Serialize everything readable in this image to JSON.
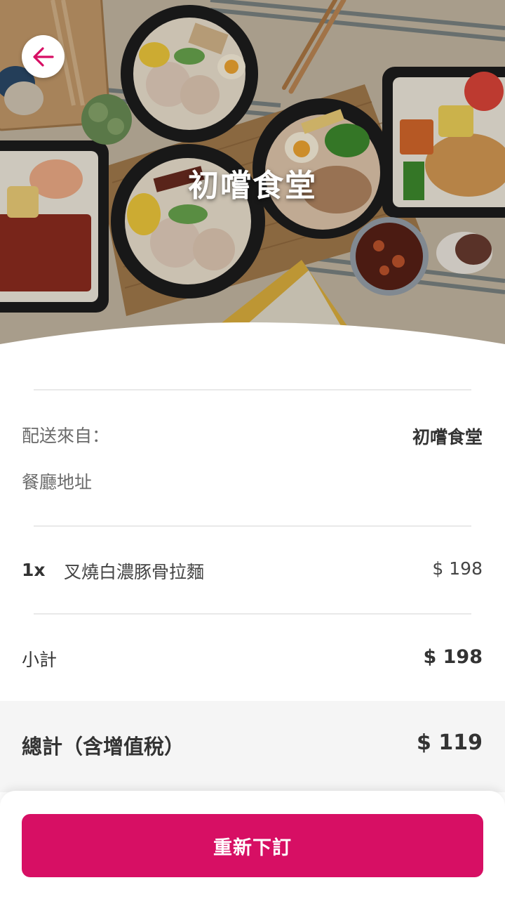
{
  "header": {
    "restaurant_name": "初嚐食堂",
    "back_icon": "arrow-left-icon"
  },
  "order": {
    "delivery_from_label": "配送來自：",
    "delivery_from_value": "初嚐食堂",
    "address_label": "餐廳地址",
    "items": [
      {
        "qty": "1x",
        "name": "叉燒白濃豚骨拉麵",
        "price": "$ 198"
      }
    ],
    "subtotal_label": "小計",
    "subtotal_value": "$ 198",
    "total_label": "總計（含增值稅）",
    "total_value": "$ 119"
  },
  "actions": {
    "reorder_label": "重新下訂"
  },
  "colors": {
    "accent": "#d70f64",
    "text": "#333333",
    "muted": "#6b6b6b",
    "band": "#f5f5f5"
  }
}
